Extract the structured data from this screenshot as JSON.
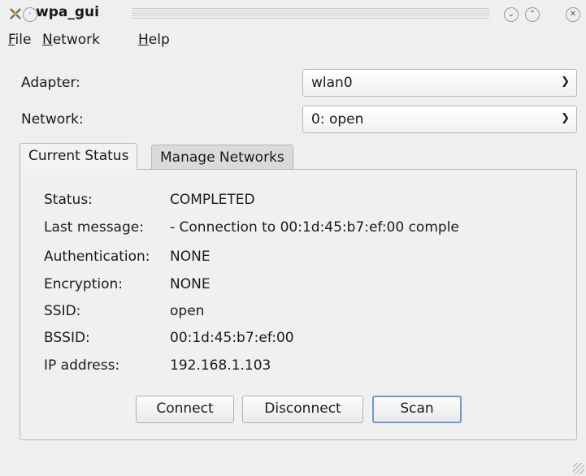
{
  "window": {
    "title": "wpa_gui",
    "app_icon": "wpa-app-icon",
    "controls": {
      "pin": "pin-icon",
      "minimize": "⌄",
      "maximize": "⌃",
      "close": "✕"
    }
  },
  "menubar": {
    "items": [
      {
        "accel": "F",
        "rest": "ile"
      },
      {
        "accel": "N",
        "rest": "etwork"
      },
      {
        "accel": "H",
        "rest": "elp"
      }
    ]
  },
  "adapter": {
    "label": "Adapter:",
    "value": "wlan0"
  },
  "network": {
    "label": "Network:",
    "value": "0: open"
  },
  "tabs": [
    {
      "label": "Current Status",
      "active": true
    },
    {
      "label": "Manage Networks",
      "active": false
    }
  ],
  "status": {
    "rows": [
      {
        "label": "Status:",
        "value": "COMPLETED"
      },
      {
        "label": "Last message:",
        "value": "- Connection to 00:1d:45:b7:ef:00 comple"
      },
      {
        "label": "Authentication:",
        "value": "NONE"
      },
      {
        "label": "Encryption:",
        "value": "NONE"
      },
      {
        "label": "SSID:",
        "value": "open"
      },
      {
        "label": "BSSID:",
        "value": "00:1d:45:b7:ef:00"
      },
      {
        "label": "IP address:",
        "value": "192.168.1.103"
      }
    ]
  },
  "buttons": {
    "connect": "Connect",
    "disconnect": "Disconnect",
    "scan": "Scan"
  },
  "colors": {
    "focus_border": "#6d9ad1",
    "window_bg": "#efefef"
  }
}
